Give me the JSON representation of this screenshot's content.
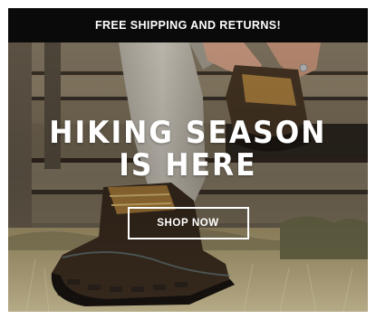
{
  "promo_bar": {
    "text": "FREE SHIPPING AND RETURNS!"
  },
  "hero": {
    "headline_line1": "HIKING SEASON",
    "headline_line2": "IS HERE",
    "cta_label": "SHOP NOW",
    "image_subject": "hiking-boots-on-wooden-steps"
  },
  "colors": {
    "promo_bg": "#0a0a0a",
    "text": "#ffffff",
    "wood": "#8a7a63",
    "pants": "#c8c2b6",
    "boot": "#3a2b1f",
    "grass": "#b7a77f"
  }
}
